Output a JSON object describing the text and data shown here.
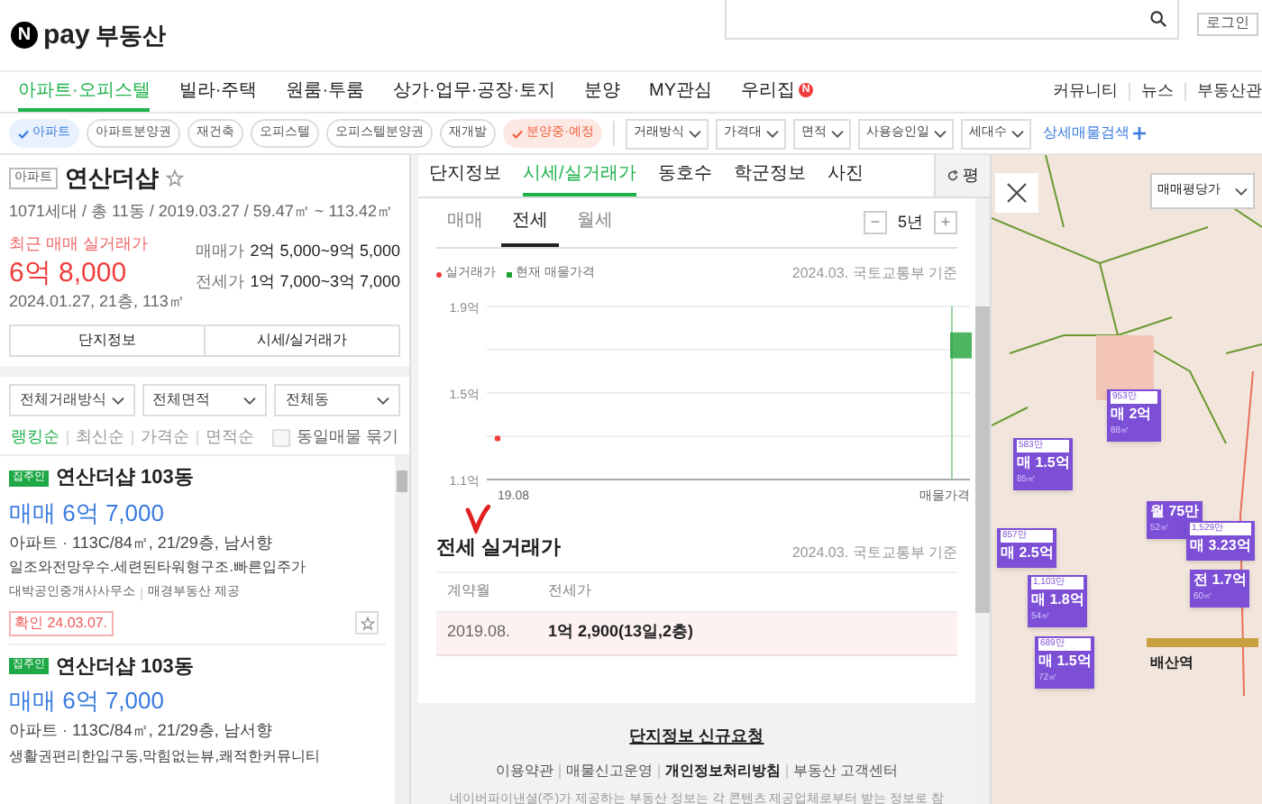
{
  "header": {
    "logo_letter": "N",
    "logo_pay": "pay",
    "logo_text": "부동산",
    "login": "로그인"
  },
  "nav": {
    "items": [
      {
        "label": "아파트·오피스텔",
        "selected": true
      },
      {
        "label": "빌라·주택",
        "selected": false
      },
      {
        "label": "원룸·투룸",
        "selected": false
      },
      {
        "label": "상가·업무·공장·토지",
        "selected": false
      },
      {
        "label": "분양",
        "selected": false
      },
      {
        "label": "MY관심",
        "selected": false
      },
      {
        "label": "우리집",
        "selected": false,
        "badge": "N"
      }
    ],
    "right": [
      "커뮤니티",
      "뉴스",
      "부동산관"
    ]
  },
  "filters": {
    "chips": [
      {
        "label": "아파트",
        "selected": true,
        "kind": "blue"
      },
      {
        "label": "아파트분양권",
        "selected": false,
        "kind": "blue"
      },
      {
        "label": "재건축",
        "selected": false,
        "kind": "blue"
      },
      {
        "label": "오피스텔",
        "selected": false,
        "kind": "blue"
      },
      {
        "label": "오피스텔분양권",
        "selected": false,
        "kind": "blue"
      },
      {
        "label": "재개발",
        "selected": false,
        "kind": "blue"
      },
      {
        "label": "분양중·예정",
        "selected": true,
        "kind": "red"
      }
    ],
    "dropdowns": [
      "거래방식",
      "가격대",
      "면적",
      "사용승인일",
      "세대수"
    ],
    "detail_search": "상세매물검색"
  },
  "complex": {
    "type_badge": "아파트",
    "name": "연산더샵",
    "info": "1071세대 / 총 11동 / 2019.03.27 / 59.47㎡ ~ 113.42㎡",
    "recent_label": "최근 매매 실거래가",
    "recent_price": "6억 8,000",
    "recent_detail": "2024.01.27, 21층, 113㎡",
    "price_ranges": [
      {
        "label": "매매가",
        "value": "2억 5,000~9억 5,000"
      },
      {
        "label": "전세가",
        "value": "1억 7,000~3억 7,000"
      }
    ],
    "buttons": [
      "단지정보",
      "시세/실거래가"
    ]
  },
  "list_filters": [
    "전체거래방식",
    "전체면적",
    "전체동"
  ],
  "sorts": [
    {
      "label": "랭킹순",
      "selected": true
    },
    {
      "label": "최신순",
      "selected": false
    },
    {
      "label": "가격순",
      "selected": false
    },
    {
      "label": "면적순",
      "selected": false
    }
  ],
  "group_same": {
    "label": "동일매물 묶기",
    "checked": false
  },
  "listings": [
    {
      "badge": "집주인",
      "title": "연산더샵 103동",
      "price": "매매 6억 7,000",
      "spec": "아파트 · 113C/84㎡, 21/29층, 남서향",
      "desc": "일조와전망우수.세련된타워형구조.빠른입주가",
      "agency": "대박공인중개사사무소",
      "provider": "매경부동산 제공",
      "confirmed": "확인 24.03.07."
    },
    {
      "badge": "집주인",
      "title": "연산더샵 103동",
      "price": "매매 6억 7,000",
      "spec": "아파트 · 113C/84㎡, 21/29층, 남서향",
      "desc": "생활권편리한입구동,막힘없는뷰,쾌적한커뮤니티"
    }
  ],
  "detail": {
    "tabs": [
      {
        "label": "단지정보",
        "selected": false
      },
      {
        "label": "시세/실거래가",
        "selected": true
      },
      {
        "label": "동호수",
        "selected": false
      },
      {
        "label": "학군정보",
        "selected": false
      },
      {
        "label": "사진",
        "selected": false
      }
    ],
    "unit_button": "평",
    "sub_tabs": [
      {
        "label": "매매",
        "selected": false
      },
      {
        "label": "전세",
        "selected": true
      },
      {
        "label": "월세",
        "selected": false
      }
    ],
    "period": "5년",
    "minus": "−",
    "plus": "+",
    "source": "2024.03. 국토교통부 기준",
    "chart_data": {
      "type": "scatter",
      "categories": [
        "19.08",
        "매물가격"
      ],
      "ylim": [
        1.1,
        1.9
      ],
      "yticks": [
        {
          "value": 1.1,
          "label": "1.1억"
        },
        {
          "value": 1.5,
          "label": "1.5억"
        },
        {
          "value": 1.9,
          "label": "1.9억"
        }
      ],
      "ref_lines": [
        {
          "axis": "y",
          "value": 1.3
        },
        {
          "axis": "y",
          "value": 1.5
        },
        {
          "axis": "y",
          "value": 1.7
        },
        {
          "axis": "y",
          "value": 1.9
        },
        {
          "axis": "x",
          "value": "매물가격",
          "color": "#9ed3a8"
        }
      ],
      "series": [
        {
          "name": "실거래가",
          "color": "#f03c3c",
          "values": [
            1.29,
            null
          ]
        },
        {
          "name": "현재 매물가격",
          "color": "#22a33a",
          "values": [
            null,
            1.72
          ]
        }
      ]
    },
    "history_title": "전세 실거래가",
    "history_source": "2024.03. 국토교통부 기준",
    "columns": [
      "계약월",
      "전세가"
    ],
    "rows": [
      [
        "2019.08.",
        "1억 2,900(13일,2층)"
      ]
    ],
    "footer_request": "단지정보 신규요청",
    "footer_links": [
      {
        "label": "이용약관",
        "bold": false
      },
      {
        "label": "매물신고운영",
        "bold": false
      },
      {
        "label": "개인정보처리방침",
        "bold": true
      },
      {
        "label": "부동산 고객센터",
        "bold": false
      }
    ],
    "footer_note": "네이버파이낸셜(주)가 제공하는 부동산 정보는 각 콘텐츠 제공업체로부터 받는 정보로 참"
  },
  "map": {
    "dropdown": "매매평당가",
    "station": "배산역",
    "markers": [
      {
        "ppp": "953만",
        "price": "매 2억",
        "area": "88㎡"
      },
      {
        "ppp": "583만",
        "price": "매 1.5억",
        "area": "85㎡"
      },
      {
        "price": "월 75만",
        "area": "52㎡"
      },
      {
        "ppp": "1,529만",
        "price": "매 3.23억"
      },
      {
        "price": "전 1.7억",
        "area": "60㎡"
      },
      {
        "ppp": "857만",
        "price": "매 2.5억"
      },
      {
        "ppp": "1,103만",
        "price": "매 1.8억",
        "area": "54㎡"
      },
      {
        "ppp": "689만",
        "price": "매 1.5억",
        "area": "72㎡"
      }
    ]
  }
}
